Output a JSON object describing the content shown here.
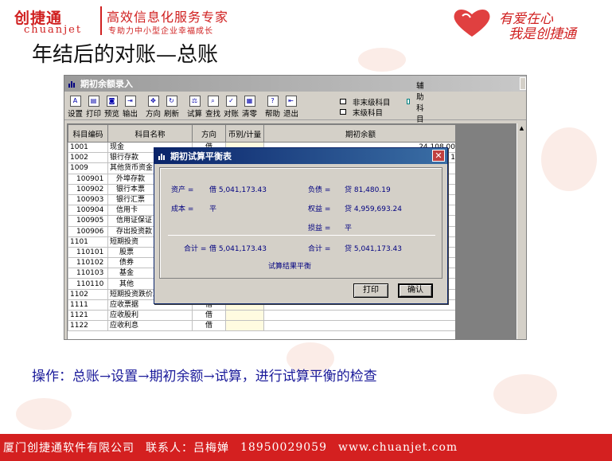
{
  "logo": {
    "cn": "创捷通",
    "en": "chuanjet",
    "slogan": "高效信息化服务专家",
    "sub": "专助力中小型企业幸福成长"
  },
  "heart_logo": {
    "line1": "有爱在心",
    "line2": "我是创捷通"
  },
  "page_title": "年结后的对账—总账",
  "app": {
    "title": "期初余额录入",
    "toolbar": [
      {
        "label": "设置",
        "icon": "settings-icon",
        "glyph": "A"
      },
      {
        "label": "打印",
        "icon": "print-icon",
        "glyph": "▤"
      },
      {
        "label": "预览",
        "icon": "preview-icon",
        "glyph": "◙"
      },
      {
        "label": "输出",
        "icon": "export-icon",
        "glyph": "⇥"
      },
      {
        "label": "方向",
        "icon": "direction-icon",
        "glyph": "✥"
      },
      {
        "label": "刷新",
        "icon": "refresh-icon",
        "glyph": "↻"
      },
      {
        "label": "试算",
        "icon": "balance-scale-icon",
        "glyph": "⚖"
      },
      {
        "label": "查找",
        "icon": "find-icon",
        "glyph": "⌕"
      },
      {
        "label": "对账",
        "icon": "reconcile-icon",
        "glyph": "✓"
      },
      {
        "label": "清零",
        "icon": "clear-icon",
        "glyph": "▦"
      },
      {
        "label": "帮助",
        "icon": "help-icon",
        "glyph": "?"
      },
      {
        "label": "退出",
        "icon": "exit-icon",
        "glyph": "⇤"
      }
    ],
    "legend": {
      "non_leaf": "非末级科目",
      "aux": "辅助科目",
      "leaf": "末级科目"
    },
    "columns": [
      "科目编码",
      "科目名称",
      "方向",
      "币别/计量",
      "期初余额"
    ],
    "rows": [
      {
        "code": "1001",
        "name": "现金",
        "dir": "借",
        "bal": "24,108.00",
        "lvl": 0
      },
      {
        "code": "1002",
        "name": "银行存款",
        "dir": "借",
        "bal": "1",
        "lvl": 0
      },
      {
        "code": "1009",
        "name": "其他货币资金",
        "dir": "",
        "bal": "",
        "lvl": 0
      },
      {
        "code": "100901",
        "name": "外埠存款",
        "dir": "",
        "bal": "",
        "lvl": 1
      },
      {
        "code": "100902",
        "name": "银行本票",
        "dir": "",
        "bal": "",
        "lvl": 1
      },
      {
        "code": "100903",
        "name": "银行汇票",
        "dir": "",
        "bal": "",
        "lvl": 1
      },
      {
        "code": "100904",
        "name": "信用卡",
        "dir": "",
        "bal": "",
        "lvl": 1
      },
      {
        "code": "100905",
        "name": "信用证保证",
        "dir": "",
        "bal": "",
        "lvl": 1
      },
      {
        "code": "100906",
        "name": "存出投资款",
        "dir": "",
        "bal": "",
        "lvl": 1
      },
      {
        "code": "1101",
        "name": "短期投资",
        "dir": "",
        "bal": "",
        "lvl": 0
      },
      {
        "code": "110101",
        "name": "股票",
        "dir": "",
        "bal": "",
        "lvl": 2
      },
      {
        "code": "110102",
        "name": "债券",
        "dir": "",
        "bal": "",
        "lvl": 2
      },
      {
        "code": "110103",
        "name": "基金",
        "dir": "",
        "bal": "",
        "lvl": 2
      },
      {
        "code": "110110",
        "name": "其他",
        "dir": "",
        "bal": "",
        "lvl": 2
      },
      {
        "code": "1102",
        "name": "短期投资跌价准备",
        "dir": "",
        "bal": "",
        "lvl": 0
      },
      {
        "code": "1111",
        "name": "应收票据",
        "dir": "借",
        "bal": "",
        "lvl": 0
      },
      {
        "code": "1121",
        "name": "应收股利",
        "dir": "借",
        "bal": "",
        "lvl": 0
      },
      {
        "code": "1122",
        "name": "应收利息",
        "dir": "借",
        "bal": "",
        "lvl": 0
      }
    ]
  },
  "dialog": {
    "title": "期初试算平衡表",
    "asset_label": "资产 =",
    "asset_value": "借 5,041,173.43",
    "liab_label": "负债 =",
    "liab_value": "贷 81,480.19",
    "cost_label": "成本 =",
    "cost_value": "平",
    "equity_label": "权益 =",
    "equity_value": "贷 4,959,693.24",
    "pl_label": "损益 =",
    "pl_value": "平",
    "total_left_label": "合计 =",
    "total_left_value": "借 5,041,173.43",
    "total_right_label": "合计 =",
    "total_right_value": "贷 5,041,173.43",
    "result": "试算结果平衡",
    "print_btn": "打印",
    "ok_btn": "确认"
  },
  "instruction": "操作：总账→设置→期初余额→试算，进行试算平衡的检查",
  "footer": {
    "company": "厦门创捷通软件有限公司",
    "contact": "联系人：吕梅婵",
    "phone": "18950029059",
    "site": "www.chuanjet.com"
  },
  "colors": {
    "brand_red": "#d02020",
    "dialog_title": "#0a246a",
    "label_blue": "#000080"
  }
}
